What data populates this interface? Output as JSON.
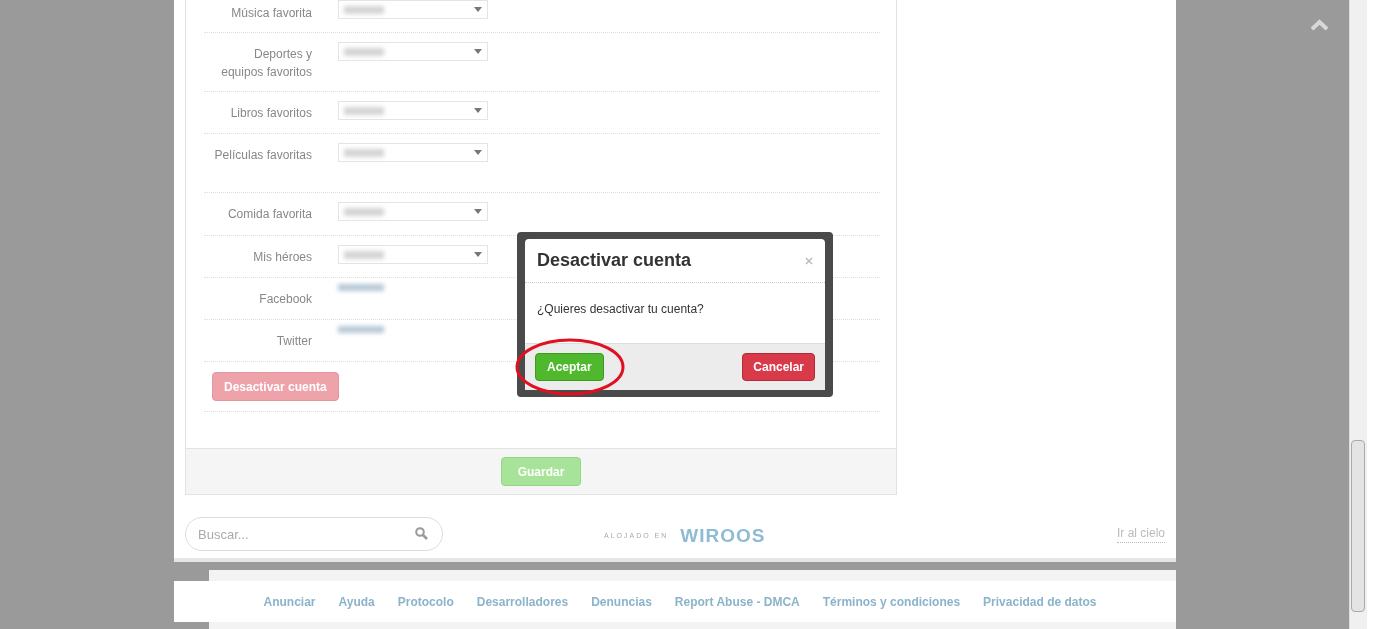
{
  "profile_form": {
    "fields": [
      {
        "label": "Música favorita",
        "kind": "select"
      },
      {
        "label": "Deportes y equipos favoritos",
        "kind": "select"
      },
      {
        "label": "Libros favoritos",
        "kind": "select"
      },
      {
        "label": "Películas favoritas",
        "kind": "select"
      },
      {
        "label": "Comida favorita",
        "kind": "select"
      },
      {
        "label": "Mis héroes",
        "kind": "select"
      },
      {
        "label": "Facebook",
        "kind": "link"
      },
      {
        "label": "Twitter",
        "kind": "link"
      }
    ],
    "deactivate_button": "Desactivar cuenta",
    "save_button": "Guardar"
  },
  "dialog": {
    "title": "Desactivar cuenta",
    "message": "¿Quieres desactivar tu cuenta?",
    "accept_button": "Aceptar",
    "cancel_button": "Cancelar",
    "accept_highlighted": true
  },
  "page_footer": {
    "search": {
      "placeholder": "Buscar..."
    },
    "hosted_label": "ALOJADO EN",
    "host_logo": "WIROOS",
    "top_link": "Ir al cielo"
  },
  "footer_links": [
    "Anunciar",
    "Ayuda",
    "Protocolo",
    "Desarrolladores",
    "Denuncias",
    "Report Abuse - DMCA",
    "Términos y condiciones",
    "Privacidad de datos"
  ]
}
